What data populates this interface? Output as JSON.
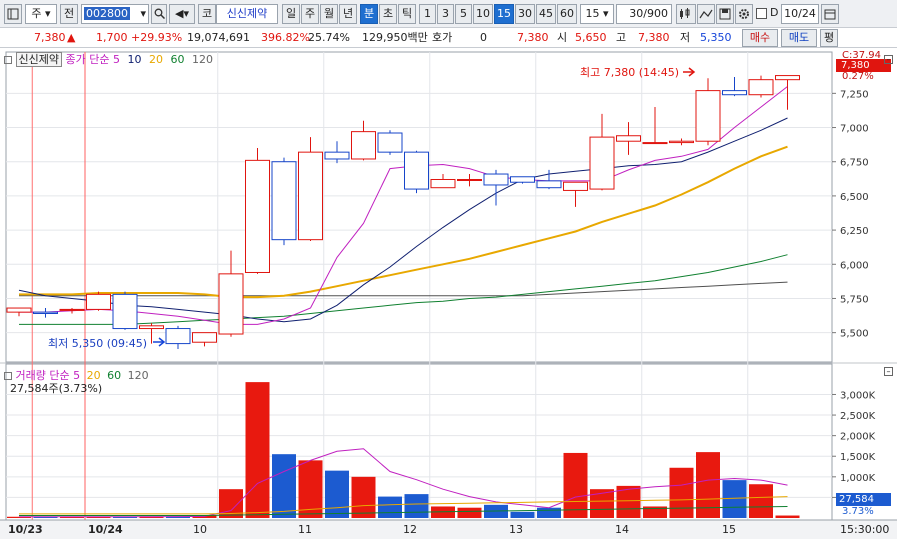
{
  "toolbar": {
    "type_select": "주",
    "prev_label": "전",
    "code_value": "002800",
    "market_label": "코",
    "stock_name": "신신제약",
    "period_day": "일",
    "period_week": "주",
    "period_month": "월",
    "period_year": "년",
    "period_min": "분",
    "period_sec": "초",
    "period_tick": "틱",
    "intervals": [
      "1",
      "3",
      "5",
      "10",
      "15",
      "30",
      "45",
      "60"
    ],
    "active_interval": "15",
    "interval_select": "15",
    "count_value": "30",
    "count_total": "/900",
    "checkbox_label": "D",
    "date_value": "10/24",
    "colors": {
      "selected": "#1f6fd0"
    }
  },
  "quote": {
    "price": "7,380",
    "arrow": "▲",
    "change": "1,700",
    "change_pct": "+29.93%",
    "volume": "19,074,691",
    "vol_ratio": "396.82%",
    "turnover": "25.74%",
    "amount": "129,950백만",
    "hoga_label": "호가",
    "hoga_value": "0",
    "hoga_price": "7,380",
    "open_label": "시",
    "open_value": "5,650",
    "high_label": "고",
    "high_value": "7,380",
    "low_label": "저",
    "low_value": "5,350",
    "buy_label": "매수",
    "sell_label": "매도",
    "eval_label": "평"
  },
  "price_panel": {
    "stock_tag": "신신제약",
    "legend_title": "종가 단순",
    "ma_periods": [
      "5",
      "10",
      "20",
      "60",
      "120"
    ],
    "ma_colors": [
      "#c020c0",
      "#102070",
      "#e8a800",
      "#108030",
      "#505050"
    ],
    "high_annotation": "최고 7,380 (14:45)",
    "low_annotation": "최저 5,350 (09:45)",
    "current_tag": "7,380",
    "change_tag": "C:37.94",
    "pct_tag": "0.27%",
    "y_ticks": [
      "7,250",
      "7,000",
      "6,750",
      "6,500",
      "6,250",
      "6,000",
      "5,750",
      "5,500"
    ]
  },
  "volume_panel": {
    "legend_title": "거래량 단순",
    "ma_periods": [
      "5",
      "20",
      "60",
      "120"
    ],
    "current_value": "27,584주(3.73%)",
    "current_tag": "27,584",
    "pct_tag": "3.73%",
    "y_ticks": [
      "3,000K",
      "2,500K",
      "2,000K",
      "1,500K",
      "1,000K",
      "500K"
    ]
  },
  "x_axis": {
    "labels": [
      "10/23",
      "10/24",
      "10",
      "11",
      "12",
      "13",
      "14",
      "15"
    ],
    "time_label": "15:30:00"
  },
  "chart_data": {
    "type": "candlestick",
    "title": "신신제약",
    "price_ylim": [
      5300,
      7450
    ],
    "volume_ylim": [
      0,
      3400
    ],
    "volume_unit": "K",
    "candles": [
      {
        "o": 5650,
        "h": 5680,
        "l": 5620,
        "c": 5680
      },
      {
        "o": 5650,
        "h": 5680,
        "l": 5610,
        "c": 5640
      },
      {
        "o": 5670,
        "h": 5680,
        "l": 5640,
        "c": 5670
      },
      {
        "o": 5670,
        "h": 5800,
        "l": 5660,
        "c": 5780
      },
      {
        "o": 5780,
        "h": 5800,
        "l": 5520,
        "c": 5530
      },
      {
        "o": 5530,
        "h": 5570,
        "l": 5420,
        "c": 5550
      },
      {
        "o": 5530,
        "h": 5550,
        "l": 5380,
        "c": 5420
      },
      {
        "o": 5430,
        "h": 5500,
        "l": 5400,
        "c": 5500
      },
      {
        "o": 5490,
        "h": 6100,
        "l": 5470,
        "c": 5930
      },
      {
        "o": 5940,
        "h": 6850,
        "l": 5930,
        "c": 6760
      },
      {
        "o": 6750,
        "h": 6780,
        "l": 6140,
        "c": 6180
      },
      {
        "o": 6180,
        "h": 6930,
        "l": 6170,
        "c": 6820
      },
      {
        "o": 6820,
        "h": 6900,
        "l": 6740,
        "c": 6770
      },
      {
        "o": 6770,
        "h": 7050,
        "l": 6760,
        "c": 6970
      },
      {
        "o": 6960,
        "h": 6980,
        "l": 6800,
        "c": 6820
      },
      {
        "o": 6820,
        "h": 6830,
        "l": 6520,
        "c": 6550
      },
      {
        "o": 6560,
        "h": 6660,
        "l": 6560,
        "c": 6620
      },
      {
        "o": 6620,
        "h": 6660,
        "l": 6570,
        "c": 6620
      },
      {
        "o": 6660,
        "h": 6690,
        "l": 6430,
        "c": 6580
      },
      {
        "o": 6640,
        "h": 6640,
        "l": 6590,
        "c": 6600
      },
      {
        "o": 6610,
        "h": 6690,
        "l": 6550,
        "c": 6560
      },
      {
        "o": 6540,
        "h": 6600,
        "l": 6420,
        "c": 6600
      },
      {
        "o": 6550,
        "h": 7100,
        "l": 6540,
        "c": 6930
      },
      {
        "o": 6900,
        "h": 7040,
        "l": 6800,
        "c": 6940
      },
      {
        "o": 6890,
        "h": 7150,
        "l": 6880,
        "c": 6890
      },
      {
        "o": 6890,
        "h": 6920,
        "l": 6870,
        "c": 6900
      },
      {
        "o": 6900,
        "h": 7360,
        "l": 6870,
        "c": 7270
      },
      {
        "o": 7270,
        "h": 7370,
        "l": 7230,
        "c": 7240
      },
      {
        "o": 7240,
        "h": 7380,
        "l": 7220,
        "c": 7350
      },
      {
        "o": 7350,
        "h": 7380,
        "l": 7130,
        "c": 7380
      }
    ],
    "ma5": [
      5650,
      5650,
      5660,
      5670,
      5660,
      5640,
      5620,
      5590,
      5560,
      5560,
      5600,
      5680,
      6050,
      6300,
      6700,
      6720,
      6730,
      6700,
      6640,
      6620,
      6610,
      6610,
      6610,
      6690,
      6760,
      6790,
      6840,
      7000,
      7150,
      7300
    ],
    "ma10": [
      5810,
      5770,
      5750,
      5730,
      5700,
      5690,
      5670,
      5650,
      5630,
      5600,
      5580,
      5600,
      5700,
      5850,
      5980,
      6130,
      6270,
      6400,
      6520,
      6620,
      6660,
      6680,
      6700,
      6720,
      6730,
      6750,
      6820,
      6900,
      6980,
      7070
    ],
    "ma20": [
      5780,
      5780,
      5780,
      5790,
      5790,
      5790,
      5790,
      5780,
      5760,
      5760,
      5770,
      5800,
      5840,
      5880,
      5920,
      5960,
      6000,
      6040,
      6090,
      6140,
      6190,
      6240,
      6310,
      6370,
      6430,
      6510,
      6600,
      6700,
      6790,
      6860
    ],
    "ma60": [
      5560,
      5560,
      5560,
      5560,
      5560,
      5570,
      5580,
      5590,
      5600,
      5610,
      5620,
      5640,
      5660,
      5680,
      5700,
      5720,
      5730,
      5750,
      5760,
      5780,
      5800,
      5820,
      5840,
      5860,
      5880,
      5910,
      5940,
      5980,
      6020,
      6070
    ],
    "ma120": [
      5770,
      5770,
      5770,
      5770,
      5770,
      5770,
      5770,
      5770,
      5770,
      5770,
      5770,
      5770,
      5770,
      5770,
      5770,
      5770,
      5770,
      5770,
      5770,
      5770,
      5780,
      5790,
      5800,
      5810,
      5820,
      5830,
      5840,
      5850,
      5860,
      5870
    ],
    "volume": [
      30,
      30,
      30,
      30,
      30,
      40,
      40,
      60,
      700,
      3300,
      1550,
      1400,
      1150,
      1000,
      520,
      580,
      280,
      250,
      320,
      150,
      250,
      1580,
      700,
      780,
      280,
      1220,
      1600,
      920,
      820,
      60
    ],
    "vol_ma5": [
      30,
      30,
      30,
      30,
      30,
      30,
      35,
      40,
      180,
      840,
      1130,
      1400,
      1620,
      1680,
      1130,
      930,
      700,
      520,
      390,
      320,
      250,
      510,
      600,
      700,
      760,
      800,
      920,
      960,
      920,
      800
    ],
    "vol_ma20": [
      100,
      100,
      100,
      100,
      100,
      100,
      100,
      100,
      110,
      130,
      160,
      210,
      250,
      300,
      320,
      340,
      350,
      360,
      370,
      380,
      390,
      400,
      410,
      420,
      430,
      440,
      460,
      480,
      500,
      520
    ],
    "vol_ma60": [
      60,
      60,
      60,
      60,
      60,
      60,
      60,
      60,
      70,
      80,
      90,
      100,
      110,
      120,
      130,
      140,
      150,
      160,
      170,
      180,
      190,
      200,
      210,
      220,
      230,
      240,
      250,
      260,
      270,
      280
    ]
  }
}
